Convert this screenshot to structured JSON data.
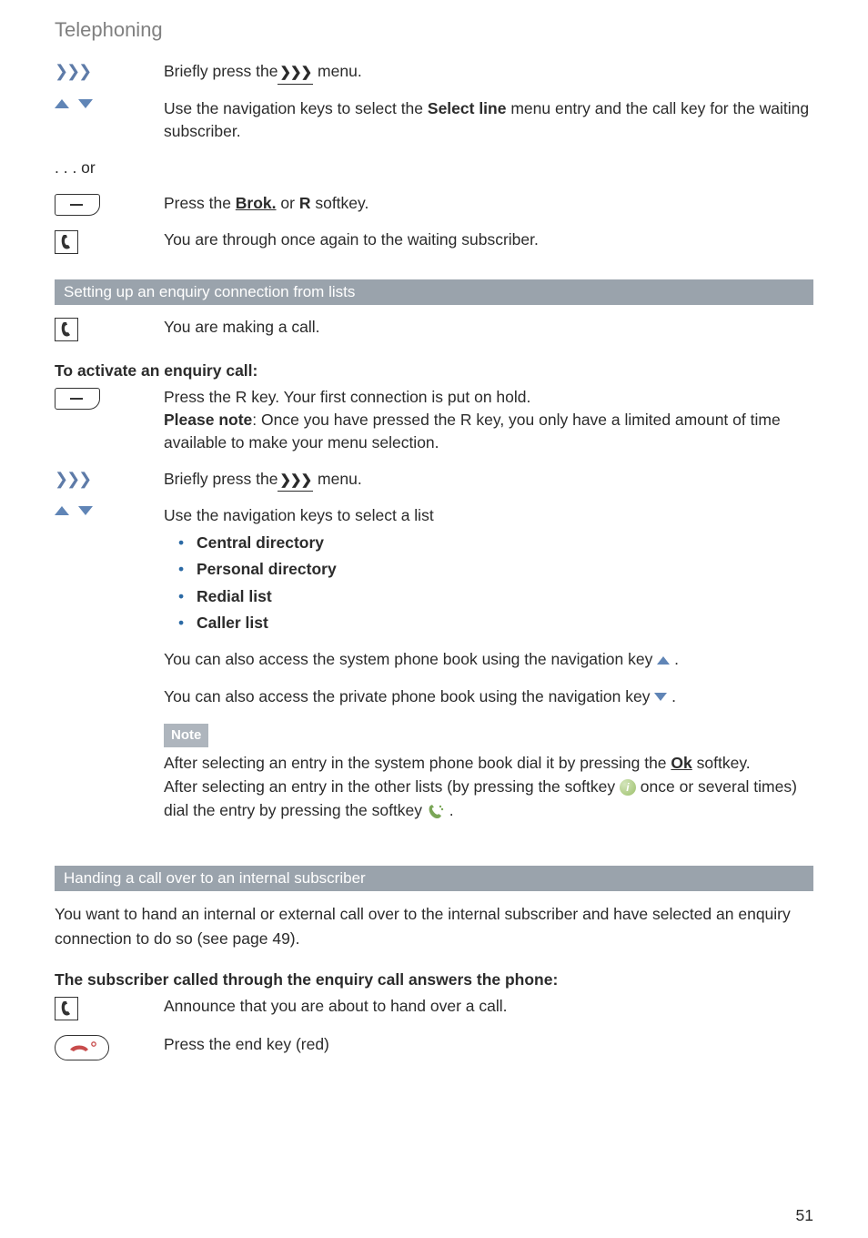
{
  "page_title": "Telephoning",
  "page_number": "51",
  "row1": {
    "prefix": "Briefly press the",
    "menu_label": "❯❯❯",
    "suffix": " menu."
  },
  "row2": {
    "prefix": "Use the navigation keys to select the ",
    "bold": "Select line",
    "suffix": " menu entry and the call key for the waiting subscriber."
  },
  "or_text": ". . . or",
  "row3": {
    "prefix": "Press the ",
    "bold_u": "Brok.",
    "mid": " or ",
    "bold2": "R",
    "suffix": " softkey."
  },
  "row4": "You are through once again to the waiting subscriber.",
  "section1": "Setting up an enquiry connection from lists",
  "row5": "You are making a call.",
  "subhead1": "To activate an enquiry call:",
  "row6_line1": "Press the R key. Your first connection is put on hold.",
  "row6_line2_bold": "Please note",
  "row6_line2": ": Once you have pressed the R key, you only have a limited amount of time available to make your menu selection.",
  "row7": {
    "prefix": "Briefly press the",
    "menu_label": "❯❯❯",
    "suffix": " menu."
  },
  "row8_intro": "Use the navigation keys to select a list",
  "bullets": {
    "b1": "Central directory",
    "b2": "Personal directory",
    "b3": "Redial list",
    "b4": "Caller list"
  },
  "row8_p1": "You can also access the system phone book using the navigation key ",
  "row8_p1_suffix": " .",
  "row8_p2": "You can also access the private phone book using the navigation key ",
  "row8_p2_suffix": " .",
  "note_label": "Note",
  "note_body": {
    "l1a": "After selecting an entry in the system phone book dial it by pressing the ",
    "l1_bold": "Ok",
    "l1b": " softkey.",
    "l2a": "After selecting an entry in the other lists (by pressing the softkey ",
    "l2b": " once or several times) dial the entry by pressing the softkey ",
    "l2c": " ."
  },
  "section2": "Handing a call over to an internal subscriber",
  "para2": "You want to hand an internal or external call over to the internal subscriber and have selected an enquiry connection to do so (see page 49).",
  "subhead2": "The subscriber called through the enquiry call answers the phone:",
  "row9": "Announce that you are about to hand over a call.",
  "row10": "Press the end key (red)"
}
